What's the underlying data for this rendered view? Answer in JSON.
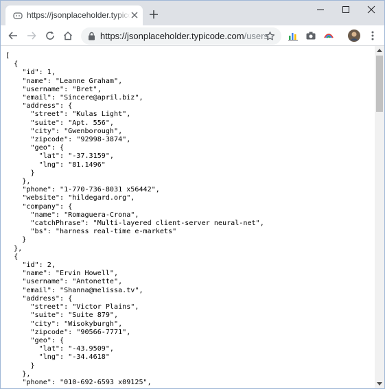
{
  "tab": {
    "title": "https://jsonplaceholder.typicode.c",
    "favicon": "jsonplaceholder-icon",
    "close": "close-icon"
  },
  "window_controls": [
    "minimize-icon",
    "maximize-icon",
    "close-icon"
  ],
  "toolbar": {
    "url_host": "https://jsonplaceholder.typicode.com",
    "url_path": "/users",
    "icons": [
      "back-icon",
      "forward-icon",
      "reload-icon",
      "home-icon",
      "lock-icon",
      "bookmark-star-icon",
      "extension-chart-icon",
      "camera-icon",
      "extension-rainbow-icon",
      "avatar",
      "menu-icon"
    ]
  },
  "colors": {
    "tabstrip": "#dee1e6",
    "omnibox": "#f1f3f4",
    "border": "#9fb7d6"
  },
  "json_lines": [
    "[",
    "  {",
    "    \"id\": 1,",
    "    \"name\": \"Leanne Graham\",",
    "    \"username\": \"Bret\",",
    "    \"email\": \"Sincere@april.biz\",",
    "    \"address\": {",
    "      \"street\": \"Kulas Light\",",
    "      \"suite\": \"Apt. 556\",",
    "      \"city\": \"Gwenborough\",",
    "      \"zipcode\": \"92998-3874\",",
    "      \"geo\": {",
    "        \"lat\": \"-37.3159\",",
    "        \"lng\": \"81.1496\"",
    "      }",
    "    },",
    "    \"phone\": \"1-770-736-8031 x56442\",",
    "    \"website\": \"hildegard.org\",",
    "    \"company\": {",
    "      \"name\": \"Romaguera-Crona\",",
    "      \"catchPhrase\": \"Multi-layered client-server neural-net\",",
    "      \"bs\": \"harness real-time e-markets\"",
    "    }",
    "  },",
    "  {",
    "    \"id\": 2,",
    "    \"name\": \"Ervin Howell\",",
    "    \"username\": \"Antonette\",",
    "    \"email\": \"Shanna@melissa.tv\",",
    "    \"address\": {",
    "      \"street\": \"Victor Plains\",",
    "      \"suite\": \"Suite 879\",",
    "      \"city\": \"Wisokyburgh\",",
    "      \"zipcode\": \"90566-7771\",",
    "      \"geo\": {",
    "        \"lat\": \"-43.9509\",",
    "        \"lng\": \"-34.4618\"",
    "      }",
    "    },",
    "    \"phone\": \"010-692-6593 x09125\","
  ]
}
